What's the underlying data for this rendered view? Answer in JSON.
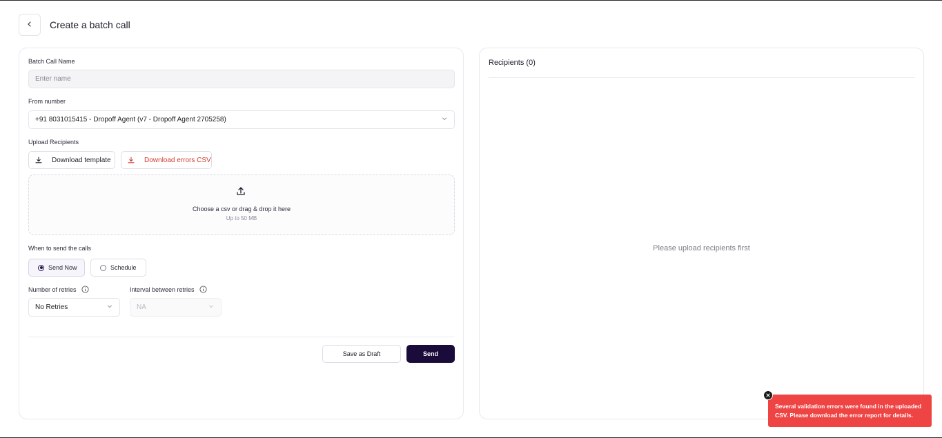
{
  "header": {
    "title": "Create a batch call",
    "back_icon": "chevron-left-icon"
  },
  "form": {
    "name_label": "Batch Call Name",
    "name_placeholder": "Enter name",
    "name_value": "",
    "from_label": "From number",
    "from_value": "+91 8031015415 - Dropoff Agent (v7 - Dropoff Agent 2705258)",
    "upload_label": "Upload Recipients",
    "download_template_label": "Download template",
    "download_errors_label": "Download errors CSV",
    "dropzone_text": "Choose a csv or drag & drop it here",
    "dropzone_subtext": "Up to 50 MB",
    "when_label": "When to send the calls",
    "send_now_label": "Send Now",
    "schedule_label": "Schedule",
    "selected_timing": "Send Now",
    "retries_label": "Number of retries",
    "retries_value": "No Retries",
    "interval_label": "Interval between retries",
    "interval_value": "NA",
    "save_draft_label": "Save as Draft",
    "send_label": "Send"
  },
  "recipients": {
    "title": "Recipients (0)",
    "empty_text": "Please upload recipients first"
  },
  "toast": {
    "message": "Several validation errors were found in the uploaded CSV. Please download the error report for details."
  },
  "colors": {
    "primary": "#1a0b3b",
    "danger": "#d23b2e",
    "toast_bg": "#ef4444"
  }
}
